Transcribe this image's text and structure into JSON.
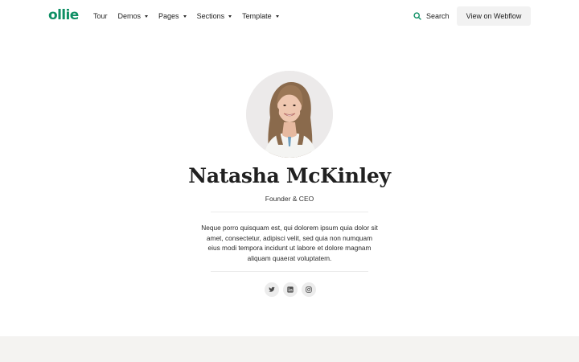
{
  "header": {
    "logo": "ollie",
    "nav": [
      {
        "label": "Tour",
        "dropdown": false
      },
      {
        "label": "Demos",
        "dropdown": true
      },
      {
        "label": "Pages",
        "dropdown": true
      },
      {
        "label": "Sections",
        "dropdown": true
      },
      {
        "label": "Template",
        "dropdown": true
      }
    ],
    "search_label": "Search",
    "cta_label": "View on Webflow"
  },
  "profile": {
    "name": "Natasha McKinley",
    "role": "Founder & CEO",
    "bio": "Neque porro quisquam est, qui dolorem ipsum quia dolor sit amet, consectetur, adipisci velit, sed quia non numquam eius modi tempora incidunt ut labore et dolore magnam aliquam quaerat voluptatem.",
    "socials": [
      "twitter-icon",
      "linkedin-icon",
      "instagram-icon"
    ]
  },
  "colors": {
    "brand": "#0e8f64",
    "button_bg": "#f2f2f2",
    "footer_bg": "#f4f3f1"
  }
}
